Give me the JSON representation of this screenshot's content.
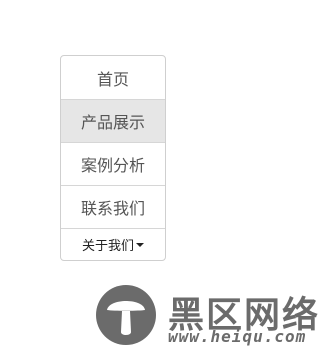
{
  "nav": {
    "items": [
      {
        "label": "首页"
      },
      {
        "label": "产品展示"
      },
      {
        "label": "案例分析"
      },
      {
        "label": "联系我们"
      }
    ],
    "dropdown_label": "关于我们"
  },
  "watermark": {
    "title": "黑区网络",
    "url": "www.heiqu.com"
  },
  "colors": {
    "active_bg": "#e6e6e6",
    "border": "#cfcfcf",
    "text": "#555555",
    "watermark": "#6b6b6b"
  }
}
